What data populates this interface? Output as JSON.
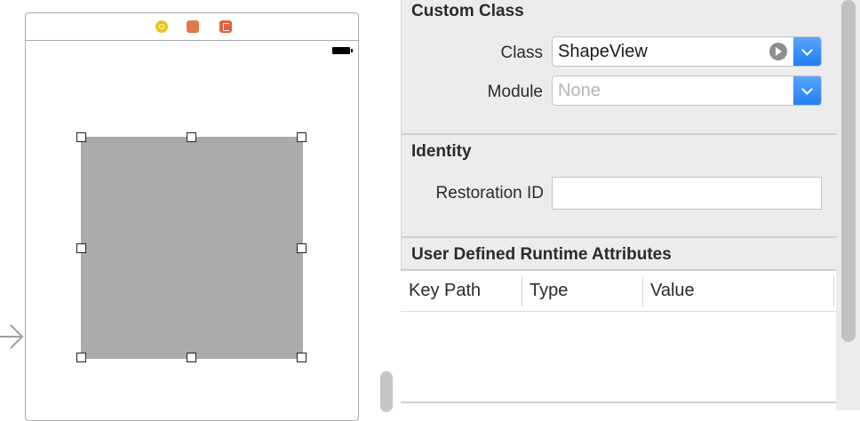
{
  "custom_class": {
    "header": "Custom Class",
    "class_label": "Class",
    "class_value": "ShapeView",
    "module_label": "Module",
    "module_value": "None"
  },
  "identity": {
    "header": "Identity",
    "restoration_label": "Restoration ID",
    "restoration_value": ""
  },
  "runtime_attributes": {
    "header": "User Defined Runtime Attributes",
    "columns": [
      "Key Path",
      "Type",
      "Value"
    ],
    "rows": []
  },
  "colors": {
    "accent": "#1f7df5",
    "shape_fill": "#aaaaaa",
    "placeholder_text": "#b5b5b5"
  },
  "icons": [
    "view-controller-icon",
    "first-responder-icon",
    "exit-icon",
    "battery-icon",
    "navigate-arrow-icon",
    "entry-point-arrow-icon",
    "chevron-down-icon"
  ]
}
